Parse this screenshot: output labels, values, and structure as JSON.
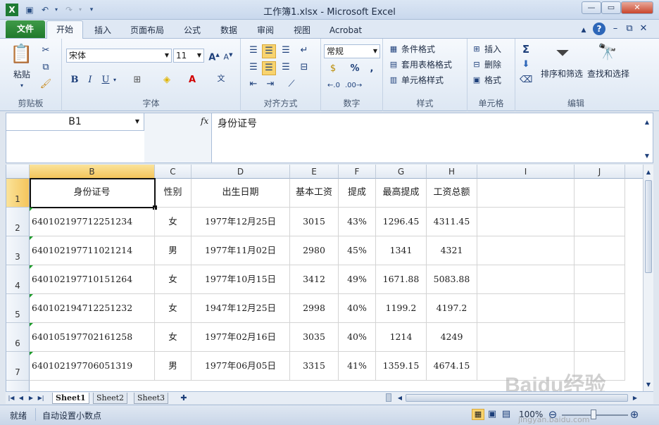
{
  "window": {
    "title": "工作簿1.xlsx - Microsoft Excel"
  },
  "tabs": [
    "文件",
    "开始",
    "插入",
    "页面布局",
    "公式",
    "数据",
    "审阅",
    "视图",
    "Acrobat"
  ],
  "ribbon": {
    "clipboard": {
      "label": "剪贴板",
      "paste": "粘贴"
    },
    "font": {
      "label": "字体",
      "name": "宋体",
      "size": "11"
    },
    "alignment": {
      "label": "对齐方式"
    },
    "number": {
      "label": "数字",
      "format": "常规",
      "percent": "%"
    },
    "styles": {
      "label": "样式",
      "conditional": "条件格式",
      "table": "套用表格格式",
      "cell": "单元格样式"
    },
    "cells": {
      "label": "单元格",
      "insert": "插入",
      "delete": "删除",
      "format": "格式"
    },
    "editing": {
      "label": "编辑",
      "sort": "排序和筛选",
      "find": "查找和选择"
    }
  },
  "formula_bar": {
    "name_box": "B1",
    "fx": "fx",
    "content": "身份证号"
  },
  "columns": [
    "B",
    "C",
    "D",
    "E",
    "F",
    "G",
    "H",
    "I",
    "J"
  ],
  "rows": [
    {
      "num": "1",
      "cells": [
        "身份证号",
        "性别",
        "出生日期",
        "基本工资",
        "提成",
        "最高提成",
        "工资总额"
      ]
    },
    {
      "num": "2",
      "cells": [
        "640102197712251234",
        "女",
        "1977年12月25日",
        "3015",
        "43%",
        "1296.45",
        "4311.45"
      ]
    },
    {
      "num": "3",
      "cells": [
        "640102197711021214",
        "男",
        "1977年11月02日",
        "2980",
        "45%",
        "1341",
        "4321"
      ]
    },
    {
      "num": "4",
      "cells": [
        "640102197710151264",
        "女",
        "1977年10月15日",
        "3412",
        "49%",
        "1671.88",
        "5083.88"
      ]
    },
    {
      "num": "5",
      "cells": [
        "640102194712251232",
        "女",
        "1947年12月25日",
        "2998",
        "40%",
        "1199.2",
        "4197.2"
      ]
    },
    {
      "num": "6",
      "cells": [
        "640105197702161258",
        "女",
        "1977年02月16日",
        "3035",
        "40%",
        "1214",
        "4249"
      ]
    },
    {
      "num": "7",
      "cells": [
        "640102197706051319",
        "男",
        "1977年06月05日",
        "3315",
        "41%",
        "1359.15",
        "4674.15"
      ]
    }
  ],
  "sheets": [
    "Sheet1",
    "Sheet2",
    "Sheet3"
  ],
  "status": {
    "ready": "就绪",
    "auto_decimal": "自动设置小数点",
    "zoom": "100%"
  },
  "watermark": {
    "brand": "Baidu经验",
    "url": "jingyan.baidu.com"
  }
}
